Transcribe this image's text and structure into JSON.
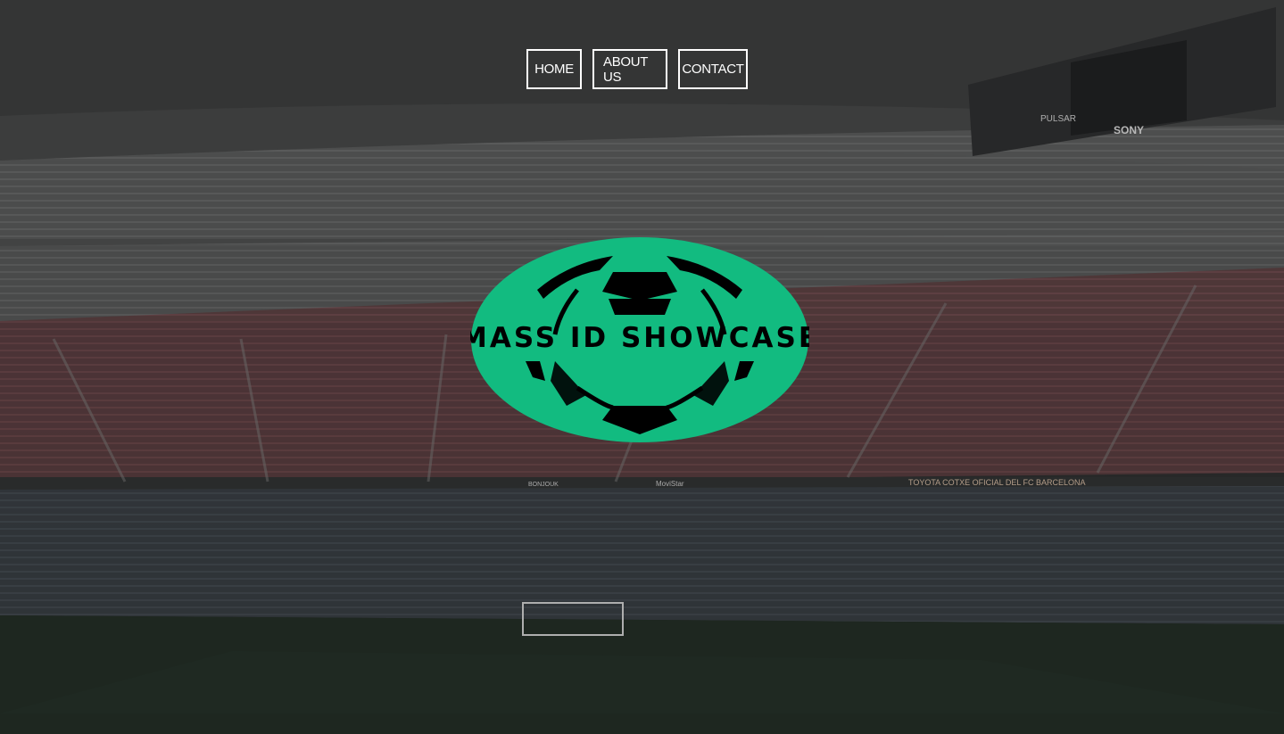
{
  "nav": {
    "items": [
      {
        "label": "HOME"
      },
      {
        "label": "ABOUT US"
      },
      {
        "label": "CONTACT"
      }
    ]
  },
  "logo": {
    "text": "MASS ID SHOWCASE",
    "icon": "soccer-ball-icon",
    "fill_color": "#12bb80",
    "ink_color": "#000000"
  },
  "background": {
    "description_icon": "stadium-photo",
    "scoreboard_brand": "SONY",
    "scoreboard_text": "PULSAR",
    "banner_sponsor": "TOYOTA COTXE OFICIAL DEL FC BARCELONA",
    "banner_movistar": "MoviStar",
    "banner_bonjouk": "BONJOUK"
  },
  "colors": {
    "accent": "#12bb80",
    "nav_border": "#ffffff",
    "nav_text": "#ffffff"
  }
}
